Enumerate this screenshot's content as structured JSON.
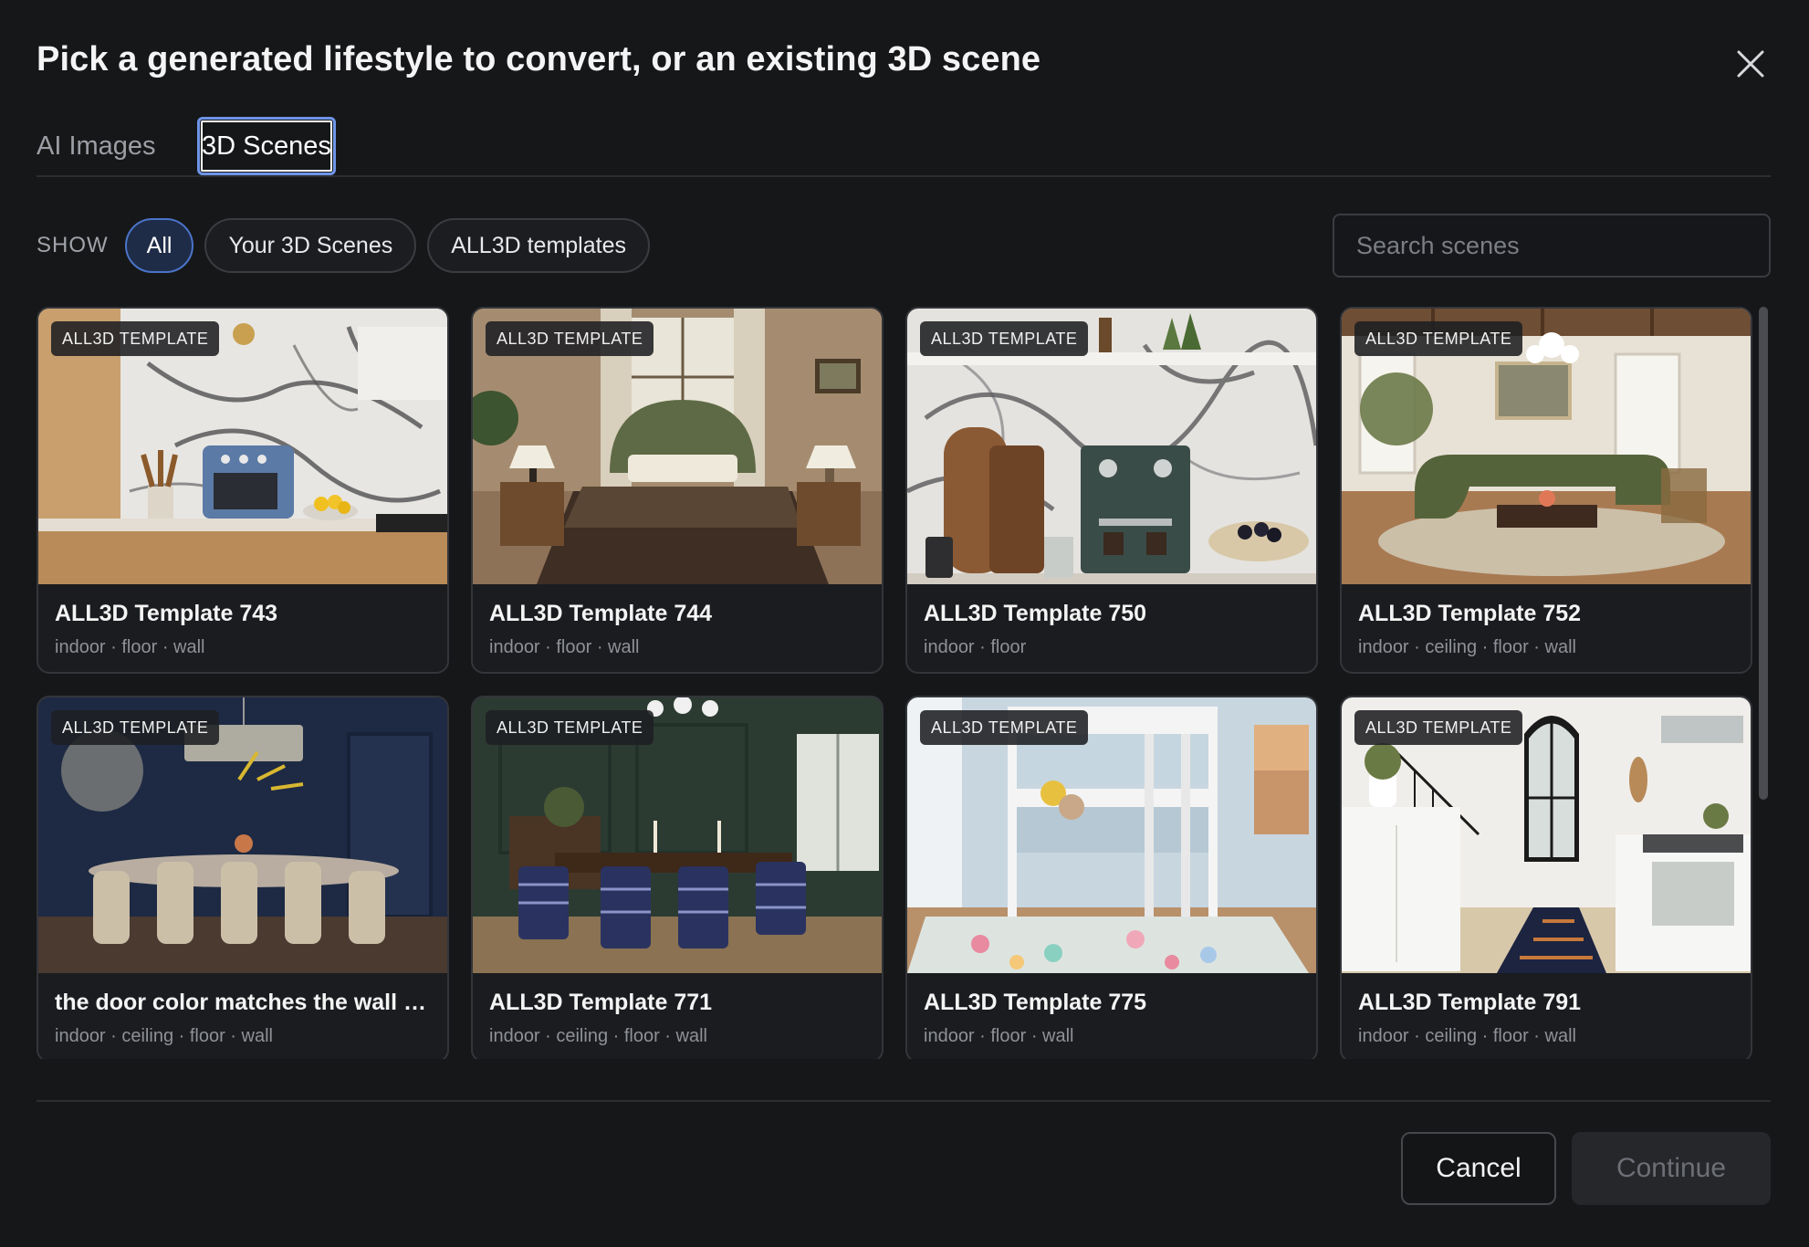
{
  "dialog": {
    "title": "Pick a generated lifestyle to convert, or an existing 3D scene",
    "close_icon": "close-icon"
  },
  "tabs": [
    {
      "label": "AI Images",
      "active": false
    },
    {
      "label": "3D Scenes",
      "active": true
    }
  ],
  "filters": {
    "show_label": "SHOW",
    "options": [
      {
        "label": "All",
        "active": true
      },
      {
        "label": "Your 3D Scenes",
        "active": false
      },
      {
        "label": "ALL3D templates",
        "active": false
      }
    ]
  },
  "search": {
    "placeholder": "Search scenes",
    "value": ""
  },
  "cards": [
    {
      "badge": "ALL3D TEMPLATE",
      "title": "ALL3D Template 743",
      "tags": "indoor · floor · wall",
      "scene": "kitchen with marble backsplash and blue air fryer"
    },
    {
      "badge": "ALL3D TEMPLATE",
      "title": "ALL3D Template 744",
      "tags": "indoor · floor · wall",
      "scene": "bedroom with green headboard"
    },
    {
      "badge": "ALL3D TEMPLATE",
      "title": "ALL3D Template 750",
      "tags": "indoor · floor",
      "scene": "kitchen counter with espresso machine"
    },
    {
      "badge": "ALL3D TEMPLATE",
      "title": "ALL3D Template 752",
      "tags": "indoor · ceiling · floor · wall",
      "scene": "living room with green sectional sofa"
    },
    {
      "badge": "ALL3D TEMPLATE",
      "title": "the door color matches the wall c...",
      "tags": "indoor · ceiling · floor · wall",
      "scene": "navy dining room with chandelier"
    },
    {
      "badge": "ALL3D TEMPLATE",
      "title": "ALL3D Template 771",
      "tags": "indoor · ceiling · floor · wall",
      "scene": "green dining room with plaid chairs"
    },
    {
      "badge": "ALL3D TEMPLATE",
      "title": "ALL3D Template 775",
      "tags": "indoor · floor · wall",
      "scene": "kids room with white bunk bed"
    },
    {
      "badge": "ALL3D TEMPLATE",
      "title": "ALL3D Template 791",
      "tags": "indoor · ceiling · floor · wall",
      "scene": "white kitchen with runner rug"
    }
  ],
  "footer": {
    "cancel_label": "Cancel",
    "continue_label": "Continue",
    "continue_disabled": true
  }
}
